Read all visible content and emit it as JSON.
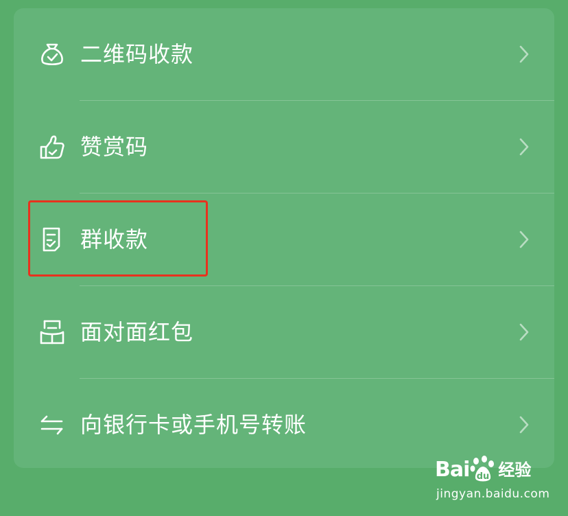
{
  "menu": {
    "items": [
      {
        "label": "二维码收款",
        "icon": "money-bag-icon"
      },
      {
        "label": "赞赏码",
        "icon": "thumbs-up-icon"
      },
      {
        "label": "群收款",
        "icon": "receipt-icon"
      },
      {
        "label": "面对面红包",
        "icon": "red-packet-icon"
      },
      {
        "label": "向银行卡或手机号转账",
        "icon": "transfer-arrows-icon"
      }
    ]
  },
  "watermark": {
    "brand_prefix": "Bai",
    "brand_suffix": "经验",
    "url": "jingyan.baidu.com"
  },
  "colors": {
    "background": "#58ad6b",
    "card": "#64b479",
    "highlight": "#e8321e",
    "text": "#ffffff"
  }
}
